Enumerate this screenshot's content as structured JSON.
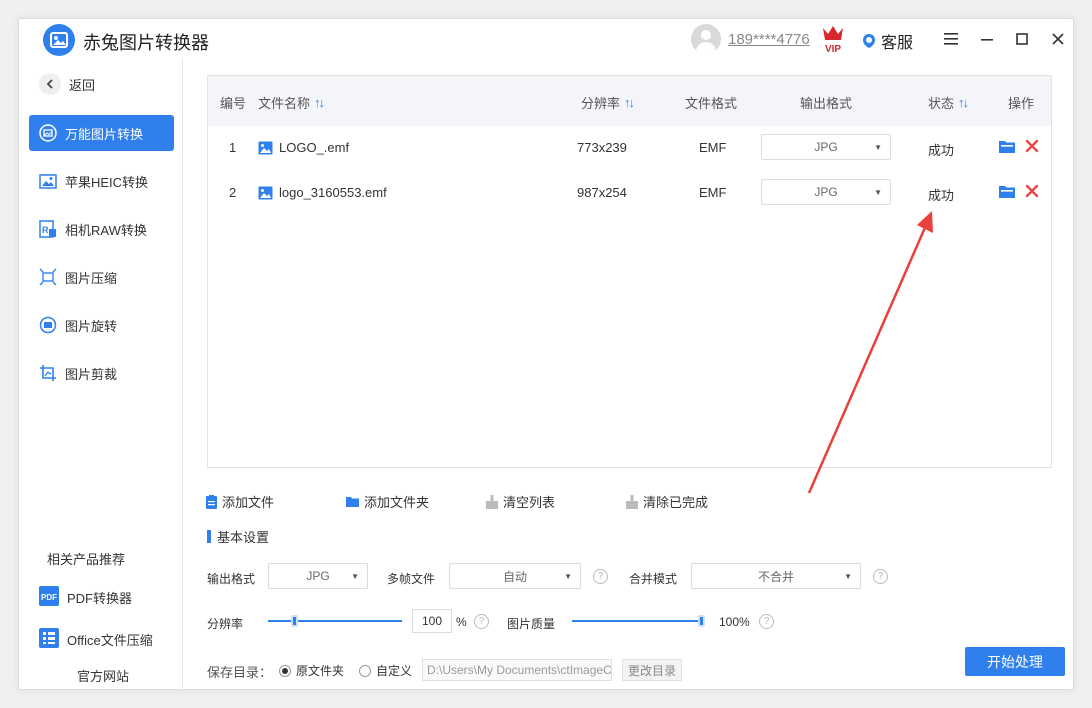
{
  "app": {
    "title": "赤兔图片转换器"
  },
  "header": {
    "phone": "189****4776",
    "service_label": "客服"
  },
  "sidebar": {
    "back_label": "返回",
    "items": [
      {
        "label": "万能图片转换",
        "icon": "image-convert-icon",
        "active": true
      },
      {
        "label": "苹果HEIC转换",
        "icon": "heic-icon"
      },
      {
        "label": "相机RAW转换",
        "icon": "raw-icon"
      },
      {
        "label": "图片压缩",
        "icon": "compress-icon"
      },
      {
        "label": "图片旋转",
        "icon": "rotate-icon"
      },
      {
        "label": "图片剪裁",
        "icon": "crop-icon"
      }
    ],
    "related_title": "相关产品推荐",
    "related": [
      {
        "label": "PDF转换器",
        "icon": "pdf-icon"
      },
      {
        "label": "Office文件压缩",
        "icon": "office-icon"
      }
    ],
    "official_site": "官方网站"
  },
  "table": {
    "columns": {
      "index": "编号",
      "name": "文件名称",
      "resolution": "分辨率",
      "format": "文件格式",
      "output": "输出格式",
      "status": "状态",
      "actions": "操作"
    },
    "rows": [
      {
        "index": "1",
        "name": "LOGO_.emf",
        "resolution": "773x239",
        "format": "EMF",
        "output": "JPG",
        "status": "成功"
      },
      {
        "index": "2",
        "name": "logo_3160553.emf",
        "resolution": "987x254",
        "format": "EMF",
        "output": "JPG",
        "status": "成功"
      }
    ]
  },
  "toolbar": {
    "add_file": "添加文件",
    "add_folder": "添加文件夹",
    "clear_list": "清空列表",
    "clear_done": "清除已完成"
  },
  "settings": {
    "title": "基本设置",
    "output_format_label": "输出格式",
    "output_format_value": "JPG",
    "multi_frame_label": "多帧文件",
    "multi_frame_value": "自动",
    "merge_mode_label": "合并模式",
    "merge_mode_value": "不合并",
    "resolution_label": "分辨率",
    "resolution_value": "100",
    "resolution_unit": "%",
    "quality_label": "图片质量",
    "quality_value": "100%",
    "resolution_fraction": 0.2,
    "quality_fraction": 1.0
  },
  "save": {
    "label": "保存目录：",
    "option_original": "原文件夹",
    "option_custom": "自定义",
    "path": "D:\\Users\\My Documents\\ctImageC",
    "change_dir": "更改目录"
  },
  "start_button": "开始处理",
  "colors": {
    "accent": "#2f80ed",
    "delete": "#e84545",
    "annotation_arrow": "#e8403a",
    "vip": "#d9262c"
  }
}
